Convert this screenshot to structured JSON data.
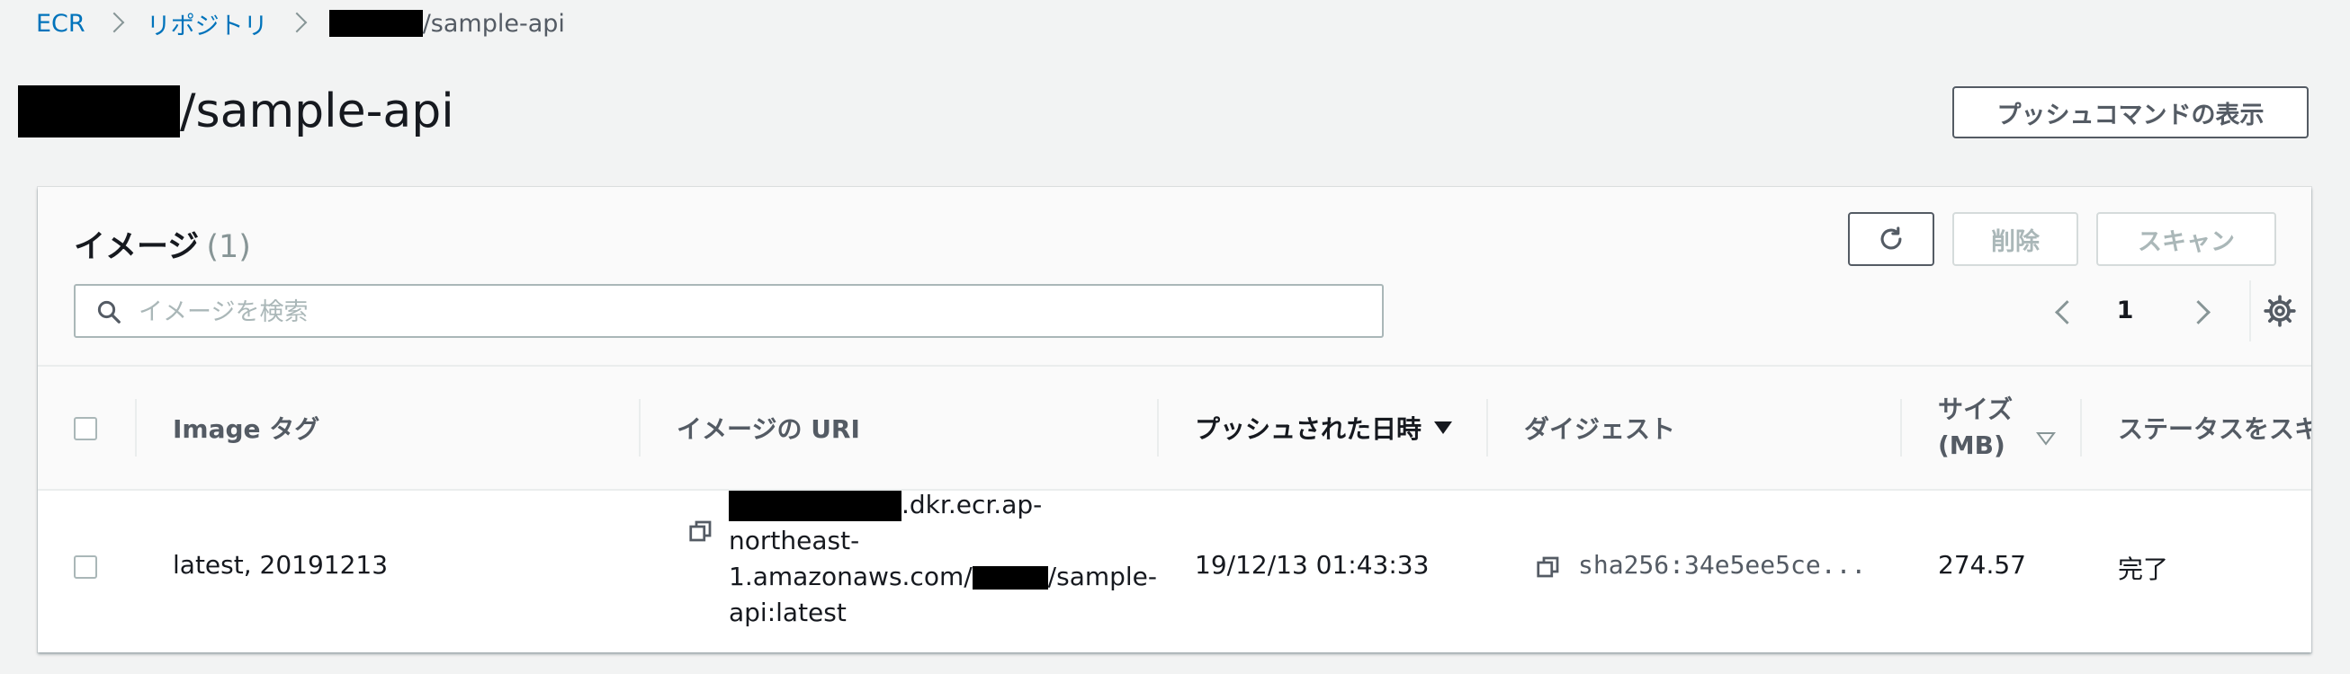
{
  "breadcrumb": {
    "ecr": "ECR",
    "repositories": "リポジトリ",
    "current_suffix": "/sample-api"
  },
  "page": {
    "title_suffix": "/sample-api",
    "push_commands_button": "プッシュコマンドの表示"
  },
  "images_panel": {
    "title": "イメージ",
    "count": "(1)",
    "delete_button": "削除",
    "scan_button": "スキャン",
    "search_placeholder": "イメージを検索",
    "current_page": "1"
  },
  "table": {
    "columns": {
      "image_tag": "Image タグ",
      "image_uri": "イメージの URI",
      "pushed_at": "プッシュされた日時",
      "digest": "ダイジェスト",
      "size_line1": "サイズ",
      "size_line2": "(MB)",
      "scan_status": "ステータスをスキャン"
    },
    "rows": [
      {
        "image_tag": "latest, 20191213",
        "uri_part1": ".dkr.ecr.ap-",
        "uri_part2": "northeast-",
        "uri_part3a": "1.amazonaws.com/",
        "uri_part3b": "/sample-",
        "uri_part4": "api:latest",
        "pushed_at": "19/12/13 01:43:33",
        "digest": "sha256:34e5ee5ce...",
        "size": "274.57",
        "scan_status": "完了"
      }
    ]
  },
  "colors": {
    "link": "#0073bb",
    "background": "#f2f3f3",
    "text": "#16191f",
    "muted": "#545b64",
    "disabled": "#aab7b8"
  },
  "icons": [
    "search-icon",
    "refresh-icon",
    "chevron-left-icon",
    "chevron-right-icon",
    "settings-gear-icon",
    "copy-icon",
    "sort-descending-icon",
    "sort-icon"
  ]
}
